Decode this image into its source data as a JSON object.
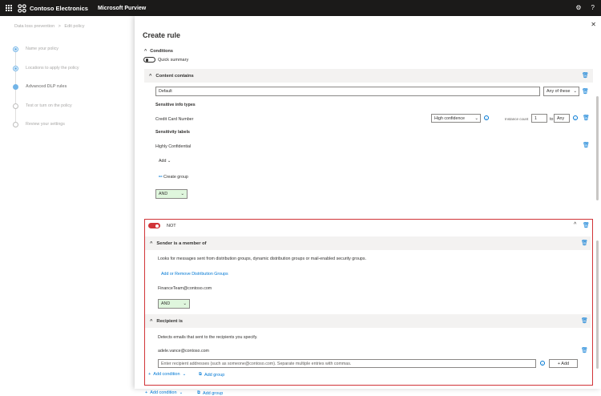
{
  "topbar": {
    "company": "Contoso Electronics",
    "product": "Microsoft Purview",
    "icons": [
      "waffle-icon",
      "gear-icon",
      "help-icon"
    ]
  },
  "breadcrumb": {
    "root": "Data loss prevention",
    "separator": ">",
    "current": "Edit policy"
  },
  "steps": [
    {
      "label": "Name your policy",
      "state": "done"
    },
    {
      "label": "Locations to apply the policy",
      "state": "done"
    },
    {
      "label": "Advanced DLP rules",
      "state": "active"
    },
    {
      "label": "Test or turn on the policy",
      "state": "todo"
    },
    {
      "label": "Review your settings",
      "state": "todo"
    }
  ],
  "panel": {
    "title": "Create rule",
    "conditions_label": "Conditions",
    "quick_summary_label": "Quick summary"
  },
  "content_contains": {
    "header": "Content contains",
    "group_name_value": "Default",
    "match_select": "Any of these",
    "sit_header": "Sensitive info types",
    "sit_name": "Credit Card Number",
    "confidence_select": "High confidence",
    "instance_label": "Instance count",
    "instance_min": "1",
    "instance_to": "to",
    "instance_max": "Any",
    "labels_header": "Sensitivity labels",
    "label_name": "Highly Confidential",
    "add_label": "Add",
    "create_group": "Create group",
    "operator": "AND"
  },
  "not_group": {
    "label": "NOT",
    "sender": {
      "header": "Sender is a member of",
      "description": "Looks for messages sent from distribution groups, dynamic distribution groups or mail-enabled security groups.",
      "link": "Add or Remove Distribution Groups",
      "value": "FinanceTeam@contoso.com",
      "operator": "AND"
    },
    "recipient": {
      "header": "Recipient is",
      "description": "Detects emails that sent to the recipients you specify.",
      "value": "adele.vance@contoso.com",
      "input_placeholder": "Enter recipient addresses (such as someone@contoso.com). Separate multiple entries with commas.",
      "add_button": "+ Add"
    },
    "add_condition": "Add condition",
    "add_group": "Add group"
  },
  "footer": {
    "add_condition": "Add condition",
    "add_group": "Add group"
  },
  "colors": {
    "accent": "#0078d4",
    "not_border": "#d13438",
    "operator_bg": "#dff6dd",
    "topbar": "#1b1a19"
  }
}
